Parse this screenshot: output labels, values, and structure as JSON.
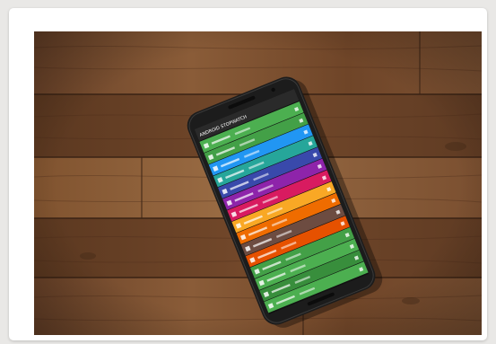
{
  "photo": {
    "subject": "smartphone-on-wooden-table",
    "colors": {
      "card_bg": "#ffffff",
      "page_bg": "#e9e8e6",
      "wood_dark": "#5e3a24",
      "wood_mid": "#7a5032",
      "wood_light": "#93653f",
      "phone_body": "#1c1c1c",
      "screen_header": "#2a2a2a"
    }
  },
  "screen": {
    "header_left": "ANDROID STOPWATCH",
    "header_right": "",
    "rows": [
      {
        "color": "#4caf50",
        "left": "",
        "right": ""
      },
      {
        "color": "#43a047",
        "left": "",
        "right": ""
      },
      {
        "color": "#2196f3",
        "left": "",
        "right": ""
      },
      {
        "color": "#26a69a",
        "left": "",
        "right": ""
      },
      {
        "color": "#3949ab",
        "left": "",
        "right": ""
      },
      {
        "color": "#8e24aa",
        "left": "",
        "right": ""
      },
      {
        "color": "#d81b60",
        "left": "",
        "right": ""
      },
      {
        "color": "#f9a825",
        "left": "",
        "right": ""
      },
      {
        "color": "#ef6c00",
        "left": "",
        "right": ""
      },
      {
        "color": "#6d4c41",
        "left": "",
        "right": ""
      },
      {
        "color": "#e65100",
        "left": "",
        "right": ""
      },
      {
        "color": "#43a047",
        "left": "",
        "right": ""
      },
      {
        "color": "#4caf50",
        "left": "",
        "right": ""
      },
      {
        "color": "#388e3c",
        "left": "",
        "right": ""
      },
      {
        "color": "#4caf50",
        "left": "",
        "right": ""
      }
    ]
  }
}
